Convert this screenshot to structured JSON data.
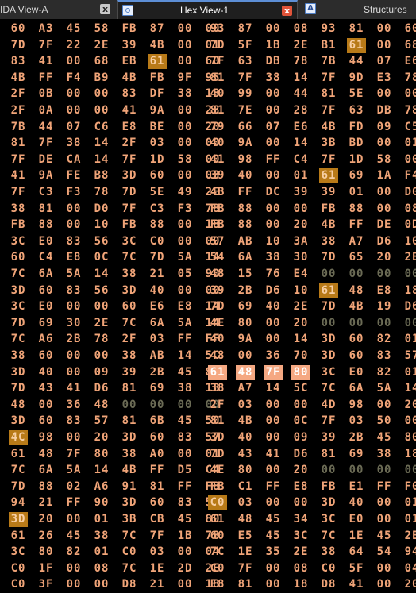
{
  "tabs": [
    {
      "label": "IDA View-A",
      "icon": "",
      "close": "x",
      "active": false
    },
    {
      "label": "Hex View-1",
      "icon": "hexview-icon",
      "close": "x",
      "active": true
    },
    {
      "label": "Structures",
      "icon": "A",
      "active": false
    }
  ],
  "colors": {
    "byte": "#f0a478",
    "zero": "#6b6b55",
    "highlight": "#b87a18",
    "selection": "#f5a882"
  },
  "hex_rows": [
    "60 A3 45 58 FB 87 00 00 93 87 00 08 93 81 00 60",
    "7D 7F 22 2E 39 4B 00 01 7D 5F 1B 2E B1 61 00 68",
    "83 41 00 68 EB 61 00 60 7F 63 DB 78 7B 44 07 E6",
    "4B FF F4 B9 4B FB 9F 95 81 7F 38 14 7F 9D E3 78",
    "2F 0B 00 00 83 DF 38 18 40 99 00 44 81 5E 00 00",
    "2F 0A 00 00 41 9A 00 28 81 7E 00 28 7F 63 DB 78",
    "7B 44 07 C6 E8 BE 00 20 79 66 07 E6 4B FD 09 C5",
    "81 7F 38 14 2F 03 00 00 40 9A 00 14 3B BD 00 01",
    "7F DE CA 14 7F 1D 58 00 41 98 FF C4 7F 1D 58 00",
    "41 9A FE B8 3D 60 00 03 39 40 00 01 61 69 1A F4",
    "7F C3 F3 78 7D 5E 49 2E 4B FF DC 39 39 01 00 D0",
    "38 81 00 D0 7F C3 F3 78 FB 88 00 00 FB 88 00 08",
    "FB 88 00 10 FB 88 00 18 FB 88 00 20 4B FF DE 0D",
    "3C E0 83 56 3C C0 00 00 57 AB 10 3A 38 A7 D6 10",
    "60 C4 E8 0C 7C 7D 5A 14 54 6A 38 30 7D 65 20 2E",
    "7C 6A 5A 14 38 21 05 90 48 15 76 E4 00 00 00 00",
    "3D 60 83 56 3D 40 00 00 39 2B D6 10 61 48 E8 18",
    "3C E0 00 00 60 E6 E8 14 7D 69 40 2E 7D 4B 19 D6",
    "7D 69 30 2E 7C 6A 5A 14 4E 80 00 20 00 00 00 00",
    "7C A6 2B 78 2F 03 FF FF 40 9A 00 14 3D 60 82 01",
    "38 60 00 00 38 AB 14 5C 48 00 36 70 3D 60 83 57",
    "3D 40 00 09 39 2B 45 80 61 48 7F 80 3C E0 82 01",
    "7D 43 41 D6 81 69 38 18 38 A7 14 5C 7C 6A 5A 14",
    "48 00 36 48 00 00 00 00 2F 03 00 00 4D 98 00 20",
    "3D 60 83 57 81 6B 45 50 81 4B 00 0C 7F 03 50 00",
    "4C 98 00 20 3D 60 83 57 3D 40 00 09 39 2B 45 80",
    "61 48 7F 80 38 A0 00 01 7D 43 41 D6 81 69 38 18",
    "7C 6A 5A 14 4B FF D5 C4 4E 80 00 20 00 00 00 00",
    "7D 88 02 A6 91 81 FF F8 FB C1 FF E8 FB E1 FF F0",
    "94 21 FF 90 3D 60 83 57 C0 03 00 00 3D 40 00 01",
    "3D 20 00 01 3B CB 45 80 61 48 45 34 3C E0 00 01",
    "61 26 45 38 7C 7F 1B 78 60 E5 45 3C 7C 1E 45 2E",
    "3C 80 82 01 C0 03 00 04 7C 1E 35 2E 38 64 54 94",
    "C0 1F 00 08 7C 1E 2D 2E C0 7F 00 08 C0 5F 00 04",
    "C0 3F 00 00 D8 21 00 18 E8 81 00 18 D8 41 00 20"
  ]
}
